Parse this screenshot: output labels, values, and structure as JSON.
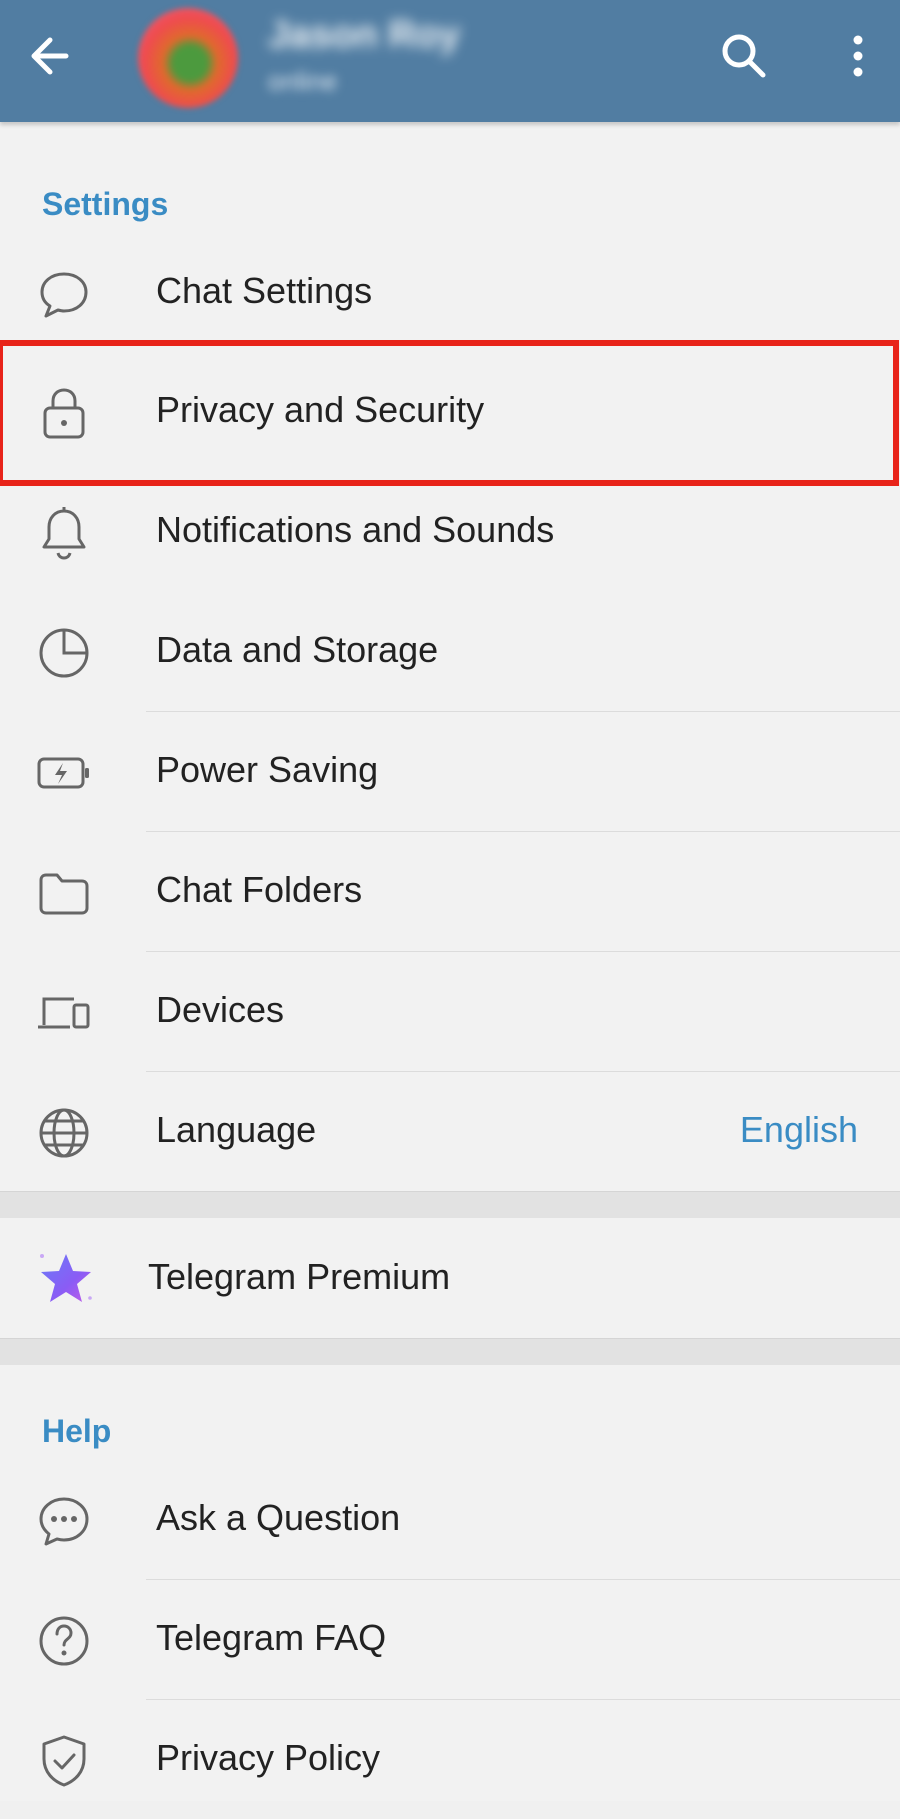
{
  "header": {
    "user_name": "Jason Roy",
    "user_status": "online",
    "back_icon": "arrow-left-icon",
    "search_icon": "search-icon",
    "more_icon": "more-vertical-icon",
    "bar_color": "#517da2"
  },
  "settings_section": {
    "title": "Settings",
    "items": [
      {
        "label": "Chat Settings",
        "icon": "chat-bubble-icon"
      },
      {
        "label": "Privacy and Security",
        "icon": "lock-icon",
        "highlighted": true
      },
      {
        "label": "Notifications and Sounds",
        "icon": "bell-icon"
      },
      {
        "label": "Data and Storage",
        "icon": "pie-chart-icon"
      },
      {
        "label": "Power Saving",
        "icon": "battery-icon"
      },
      {
        "label": "Chat Folders",
        "icon": "folder-icon"
      },
      {
        "label": "Devices",
        "icon": "devices-icon"
      },
      {
        "label": "Language",
        "icon": "globe-icon",
        "value": "English"
      }
    ]
  },
  "premium": {
    "label": "Telegram Premium",
    "icon": "premium-star-icon"
  },
  "help_section": {
    "title": "Help",
    "items": [
      {
        "label": "Ask a Question",
        "icon": "chat-dots-icon"
      },
      {
        "label": "Telegram FAQ",
        "icon": "question-circle-icon"
      },
      {
        "label": "Privacy Policy",
        "icon": "shield-check-icon"
      }
    ]
  },
  "colors": {
    "accent": "#3a8cc4",
    "highlight_border": "#e8241a",
    "premium_star": "#8a5cf5"
  }
}
